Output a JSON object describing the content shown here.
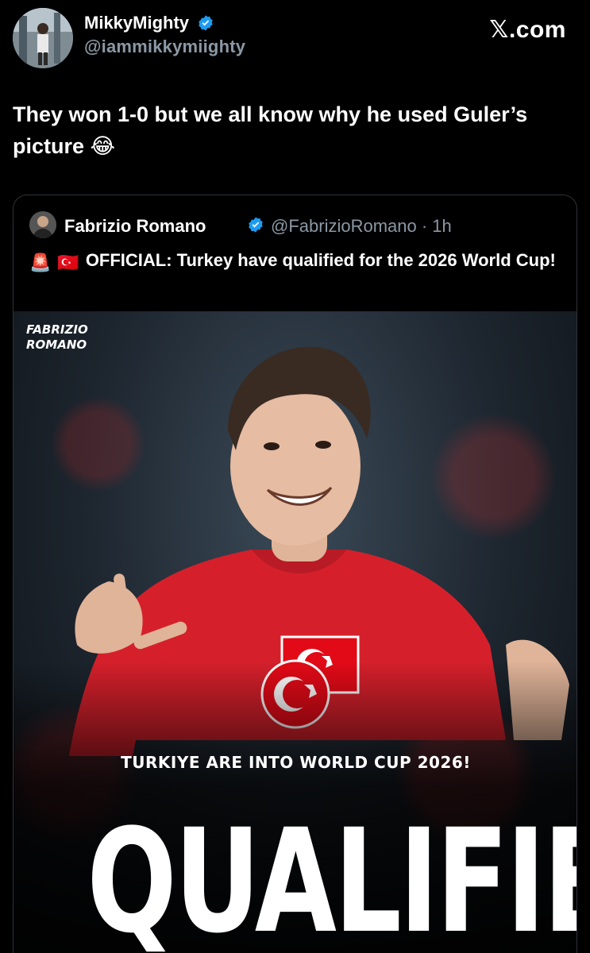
{
  "tweet": {
    "display_name": "MikkyMighty",
    "handle": "@iammikkymiighty",
    "text": "They won 1-0 but we all know why he used Guler’s picture 😂",
    "brand_label": "𝕏.com"
  },
  "quote": {
    "display_name": "Fabrizio Romano",
    "handle_time": "@FabrizioRomano · 1h",
    "text": "OFFICIAL: Turkey have qualified for the 2026 World Cup!",
    "emojis": [
      "🚨",
      "🇹🇷"
    ]
  },
  "media": {
    "brand_line1": "FABRIZIO",
    "brand_line2": "ROMANO",
    "subhead": "TURKIYE ARE INTO WORLD CUP 2026!",
    "headline": "QUALIFIED"
  },
  "colors": {
    "background": "#000000",
    "verified_blue": "#1d9bf0",
    "muted_text": "#8b98a5",
    "card_border": "#2f3336",
    "jersey_red": "#d5202b"
  },
  "icons": {
    "verified": "verified-badge-icon",
    "x_logo": "x-logo-icon"
  }
}
